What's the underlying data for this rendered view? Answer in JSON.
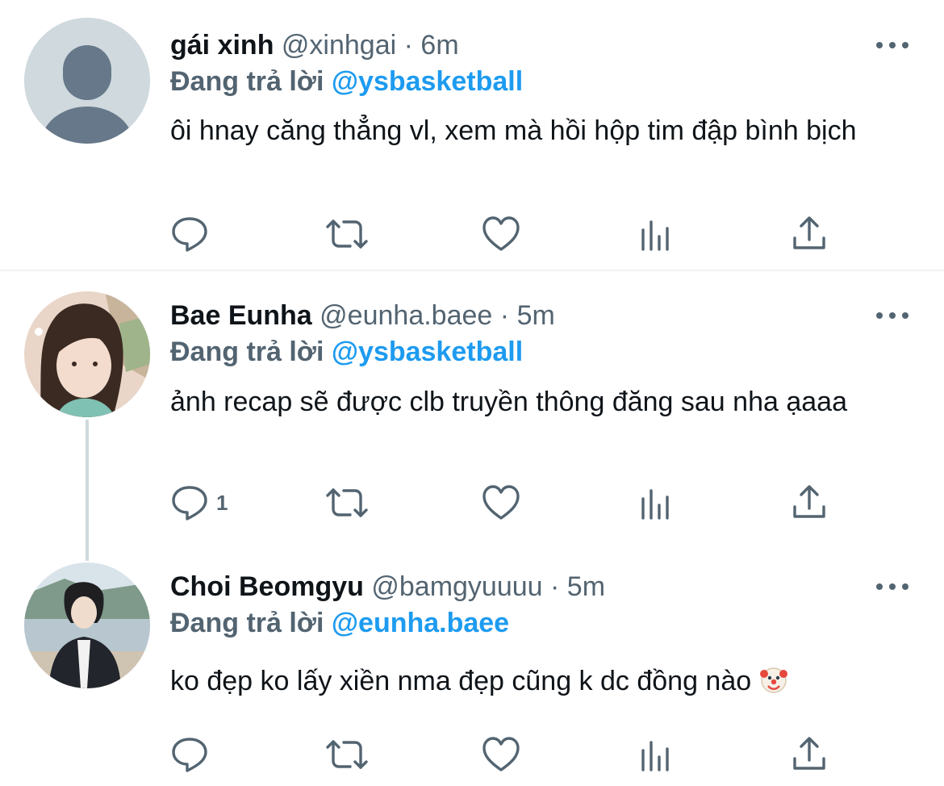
{
  "tweets": [
    {
      "display_name": "gái xinh",
      "handle": "@xinhgai",
      "separator": "·",
      "time": "6m",
      "replying_prefix": "Đang trả lời",
      "replying_to": "@ysbasketball",
      "text": "ôi hnay căng thẳng vl, xem mà hồi hộp tim đập bình bịch",
      "reply_count": "",
      "avatar": "default-avatar-icon"
    },
    {
      "display_name": "Bae Eunha",
      "handle": "@eunha.baee",
      "separator": "·",
      "time": "5m",
      "replying_prefix": "Đang trả lời",
      "replying_to": "@ysbasketball",
      "text": "ảnh recap sẽ được clb truyền thông đăng sau nha ạaaa",
      "reply_count": "1",
      "avatar": "user-photo"
    },
    {
      "display_name": "Choi Beomgyu",
      "handle": "@bamgyuuuu",
      "separator": "·",
      "time": "5m",
      "replying_prefix": "Đang trả lời",
      "replying_to": "@eunha.baee",
      "text": "ko đẹp ko lấy xiền nma đẹp cũng k dc đồng nào",
      "text_emoji": "clown-face-emoji",
      "reply_count": "",
      "avatar": "user-photo"
    }
  ],
  "icons": {
    "reply": "reply-icon",
    "retweet": "retweet-icon",
    "like": "like-icon",
    "analytics": "analytics-icon",
    "share": "share-icon",
    "more": "more-icon"
  },
  "colors": {
    "text": "#0f1419",
    "secondary": "#536471",
    "link": "#1d9bf0",
    "divider": "#eff3f4",
    "thread_line": "#cfd9de"
  }
}
